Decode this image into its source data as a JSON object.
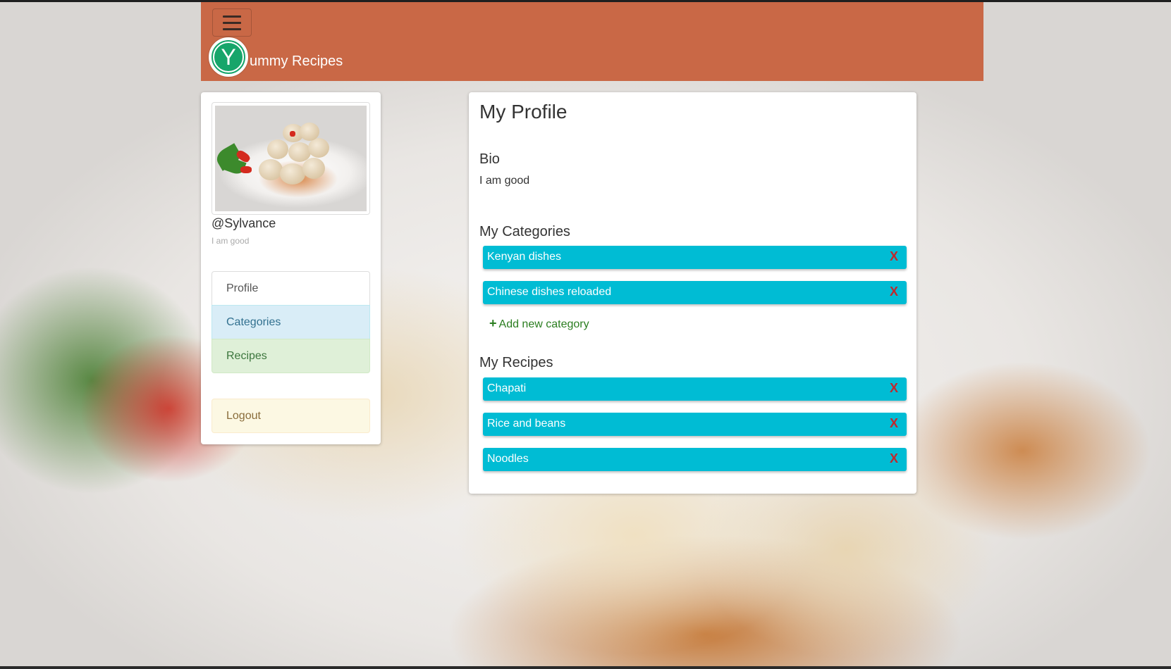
{
  "app": {
    "brand_initial": "Y",
    "brand_text": "ummy Recipes"
  },
  "sidebar": {
    "username": "@Sylvance",
    "bio": "I am good",
    "nav": [
      {
        "label": "Profile"
      },
      {
        "label": "Categories"
      },
      {
        "label": "Recipes"
      }
    ],
    "logout_label": "Logout"
  },
  "main": {
    "title": "My Profile",
    "bio_heading": "Bio",
    "bio_text": "I am good",
    "categories_heading": "My Categories",
    "categories": [
      {
        "name": "Kenyan dishes",
        "delete_label": "X"
      },
      {
        "name": "Chinese dishes reloaded",
        "delete_label": "X"
      }
    ],
    "add_category_label": "Add new category",
    "recipes_heading": "My Recipes",
    "recipes": [
      {
        "name": "Chapati",
        "delete_label": "X"
      },
      {
        "name": "Rice and beans",
        "delete_label": "X"
      },
      {
        "name": "Noodles",
        "delete_label": "X"
      }
    ]
  },
  "colors": {
    "navbar": "#c96846",
    "logo": "#17a56a",
    "pill": "#00bcd4",
    "delete": "#c0282d",
    "add_link": "#2a7d1f"
  },
  "icons": {
    "menu": "hamburger-icon",
    "add": "plus-icon",
    "delete": "close-x-icon"
  }
}
